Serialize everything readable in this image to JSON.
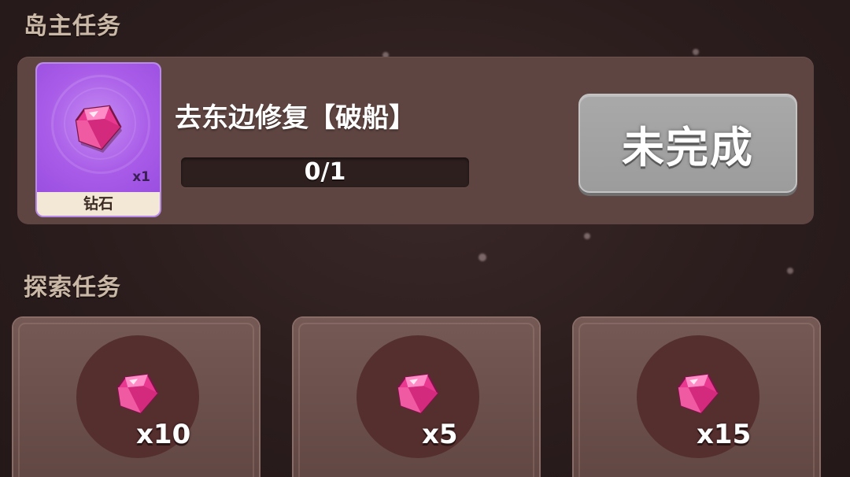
{
  "sections": {
    "island_master": "岛主任务",
    "exploration": "探索任务"
  },
  "island_task": {
    "reward": {
      "icon": "diamond-icon",
      "quantity": "x1",
      "name": "钻石"
    },
    "title": "去东边修复【破船】",
    "progress": {
      "text": "0/1",
      "current": 0,
      "total": 1
    },
    "status_button": "未完成"
  },
  "exploration_tasks": [
    {
      "reward_icon": "diamond-icon",
      "quantity": "x10"
    },
    {
      "reward_icon": "diamond-icon",
      "quantity": "x5"
    },
    {
      "reward_icon": "diamond-icon",
      "quantity": "x15"
    }
  ],
  "colors": {
    "background": "#2b1d1d",
    "card": "#5f4541",
    "reward_purple": "#a95ce8",
    "button_gray": "#a3a3a3",
    "gem_pink": "#e8388f"
  }
}
